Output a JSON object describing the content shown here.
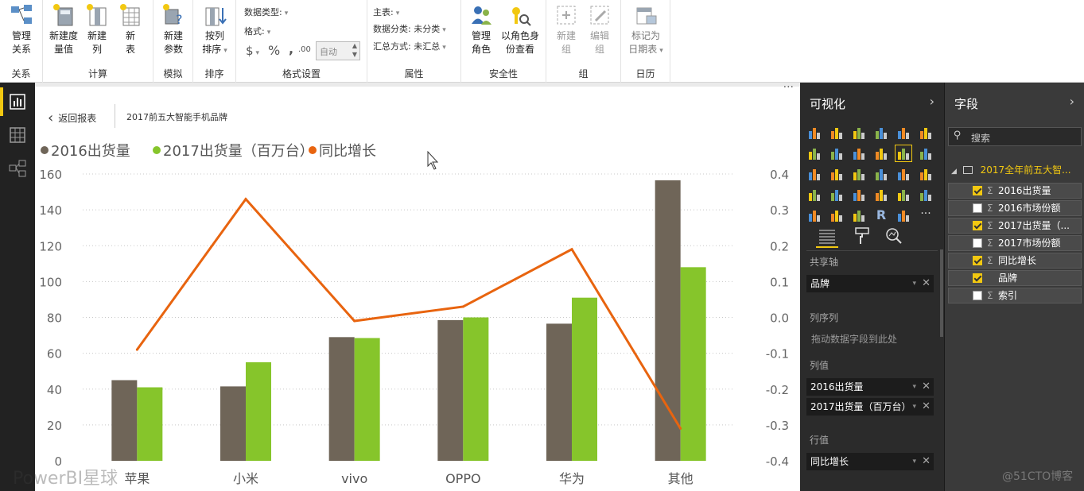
{
  "ribbon": {
    "groups": [
      {
        "label": "关系",
        "buttons": [
          {
            "line1": "管理",
            "line2": "关系"
          }
        ]
      },
      {
        "label": "计算",
        "buttons": [
          {
            "line1": "新建度",
            "line2": "量值"
          },
          {
            "line1": "新建",
            "line2": "列"
          },
          {
            "line1": "新",
            "line2": "表"
          }
        ]
      },
      {
        "label": "模拟",
        "buttons": [
          {
            "line1": "新建",
            "line2": "参数"
          }
        ]
      },
      {
        "label": "排序",
        "buttons": [
          {
            "line1": "按列",
            "line2": "排序"
          }
        ]
      },
      {
        "label": "格式设置"
      },
      {
        "label": "属性"
      },
      {
        "label": "安全性",
        "buttons": [
          {
            "line1": "管理",
            "line2": "角色"
          },
          {
            "line1": "以角色身",
            "line2": "份查看"
          }
        ]
      },
      {
        "label": "组",
        "buttons": [
          {
            "line1": "新建",
            "line2": "组"
          },
          {
            "line1": "编辑",
            "line2": "组"
          }
        ]
      },
      {
        "label": "日历",
        "buttons": [
          {
            "line1": "标记为",
            "line2": "日期表"
          }
        ]
      }
    ],
    "format": {
      "data_type": "数据类型:",
      "format": "格式:",
      "currency": "$",
      "percent": "%",
      "comma": ",",
      "decimal": ".00",
      "auto": "自动"
    },
    "props": {
      "home_table": "主表:",
      "data_category": "数据分类: 未分类",
      "summarize": "汇总方式: 未汇总"
    }
  },
  "report": {
    "back_label": "返回报表",
    "page_title": "2017前五大智能手机品牌",
    "more": "···",
    "watermark_left": "PowerBI星球",
    "watermark_right": "@51CTO博客"
  },
  "chart_data": {
    "type": "bar",
    "categories": [
      "苹果",
      "小米",
      "vivo",
      "OPPO",
      "华为",
      "其他"
    ],
    "series": [
      {
        "name": "2016出货量",
        "type": "bar",
        "color": "#6f6558",
        "values": [
          45,
          41.5,
          69,
          78.5,
          76.5,
          156.5
        ]
      },
      {
        "name": "2017出货量（百万台）",
        "type": "bar",
        "color": "#86c52b",
        "values": [
          41,
          55,
          68.5,
          80,
          91,
          108
        ]
      },
      {
        "name": "同比增长",
        "type": "line",
        "axis": "right",
        "color": "#e8640f",
        "values": [
          -0.09,
          0.33,
          -0.01,
          0.03,
          0.19,
          -0.31
        ]
      }
    ],
    "ylim": [
      0,
      160
    ],
    "yticks": [
      0,
      20,
      40,
      60,
      80,
      100,
      120,
      140,
      160
    ],
    "y2lim": [
      -0.4,
      0.4
    ],
    "y2ticks": [
      "0.4",
      "0.3",
      "0.2",
      "0.1",
      "0.0",
      "-0.1",
      "-0.2",
      "-0.3",
      "-0.4"
    ],
    "legend_position": "top-left",
    "grid": true
  },
  "vis_pane": {
    "title": "可视化",
    "shared_axis": "共享轴",
    "shared_axis_value": "品牌",
    "col_series": "列序列",
    "col_series_hint": "拖动数据字段到此处",
    "col_values": "列值",
    "col_values_items": [
      "2016出货量",
      "2017出货量（百万台）"
    ],
    "row_values": "行值",
    "row_values_item": "同比增长"
  },
  "fields_pane": {
    "title": "字段",
    "search_placeholder": "搜索",
    "table_name": "2017全年前五大智...",
    "fields": [
      {
        "name": "2016出货量",
        "checked": true,
        "sigma": true
      },
      {
        "name": "2016市场份额",
        "checked": false,
        "sigma": true
      },
      {
        "name": "2017出货量（...",
        "checked": true,
        "sigma": true
      },
      {
        "name": "2017市场份额",
        "checked": false,
        "sigma": true
      },
      {
        "name": "同比增长",
        "checked": true,
        "sigma": true
      },
      {
        "name": "品牌",
        "checked": true,
        "sigma": false
      },
      {
        "name": "索引",
        "checked": false,
        "sigma": true
      }
    ]
  }
}
